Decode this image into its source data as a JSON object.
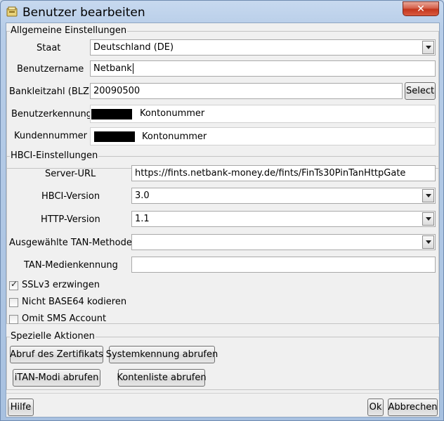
{
  "window": {
    "title": "Benutzer bearbeiten",
    "close_label": "✕"
  },
  "general": {
    "legend": "Allgemeine Einstellungen",
    "staat_label": "Staat",
    "staat_value": "Deutschland (DE)",
    "benutzername_label": "Benutzername",
    "benutzername_value": "Netbank",
    "blz_label": "Bankleitzahl (BLZ)",
    "blz_value": "20090500",
    "select_label": "Select",
    "benutzerkennung_label": "Benutzerkennung",
    "benutzerkennung_value": "Kontonummer",
    "kundennummer_label": "Kundennummer",
    "kundennummer_value": "Kontonummer"
  },
  "hbci": {
    "legend": "HBCI-Einstellungen",
    "server_url_label": "Server-URL",
    "server_url_value": "https://fints.netbank-money.de/fints/FinTs30PinTanHttpGate",
    "hbci_version_label": "HBCI-Version",
    "hbci_version_value": "3.0",
    "http_version_label": "HTTP-Version",
    "http_version_value": "1.1",
    "tan_methode_label": "Ausgewählte TAN-Methode",
    "tan_methode_value": "",
    "tan_medien_label": "TAN-Medienkennung",
    "tan_medien_value": "",
    "sslv3_label": "SSLv3 erzwingen",
    "sslv3_checked": true,
    "base64_label": "Nicht BASE64 kodieren",
    "base64_checked": false,
    "sms_label": "Omit SMS Account",
    "sms_checked": false
  },
  "actions": {
    "legend": "Spezielle Aktionen",
    "zertifikat_label": "Abruf des Zertifikats",
    "systemkennung_label": "Systemkennung abrufen",
    "itan_label": "iTAN-Modi abrufen",
    "kontenliste_label": "Kontenliste abrufen"
  },
  "footer": {
    "hilfe_label": "Hilfe",
    "ok_label": "Ok",
    "abbrechen_label": "Abbrechen"
  }
}
